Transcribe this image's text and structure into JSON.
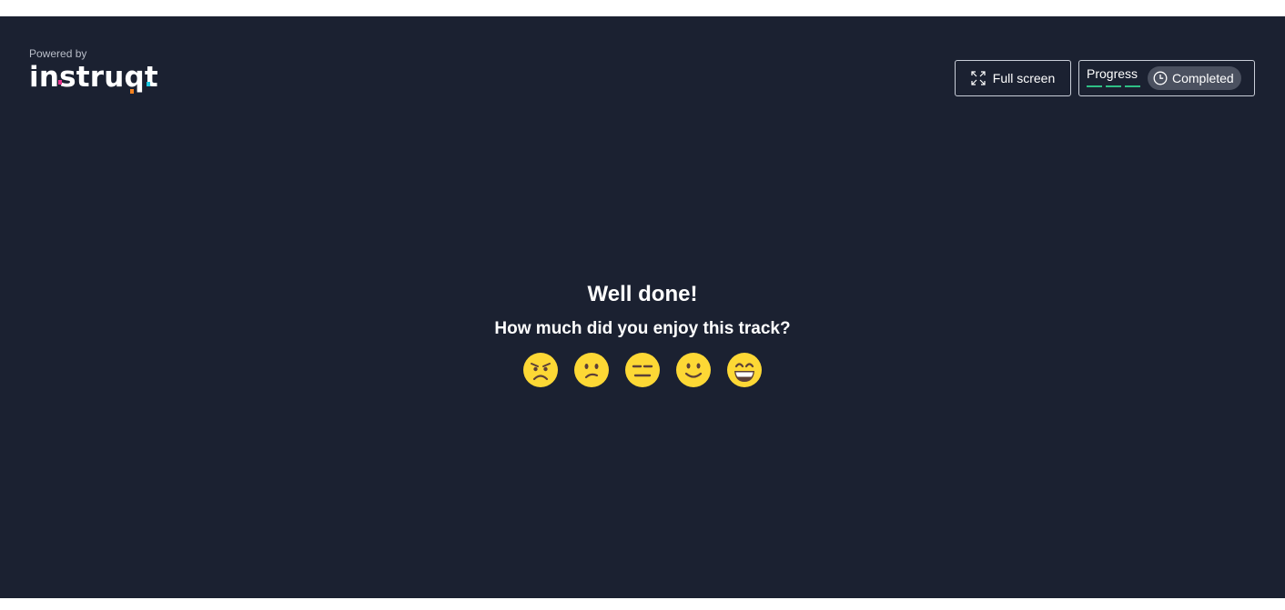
{
  "brand": {
    "powered_by": "Powered by",
    "logo_text": "instruqt"
  },
  "header": {
    "fullscreen_label": "Full screen",
    "progress_label": "Progress",
    "progress_steps_completed": 3,
    "progress_steps_total": 3,
    "status_label": "Completed"
  },
  "main": {
    "title": "Well done!",
    "question": "How much did you enjoy this track?",
    "ratings": [
      {
        "icon": "angry-face-icon",
        "value": 1
      },
      {
        "icon": "confused-face-icon",
        "value": 2
      },
      {
        "icon": "neutral-face-icon",
        "value": 3
      },
      {
        "icon": "slightly-smiling-face-icon",
        "value": 4
      },
      {
        "icon": "grinning-face-icon",
        "value": 5
      }
    ]
  },
  "colors": {
    "background": "#1b2131",
    "progress_step": "#2fbf85",
    "badge_bg": "#4b5160",
    "emoji": "#fdd835",
    "logo_accent_pink": "#e6348c",
    "logo_accent_orange": "#f5821f",
    "logo_accent_cyan": "#1ec8e0"
  }
}
